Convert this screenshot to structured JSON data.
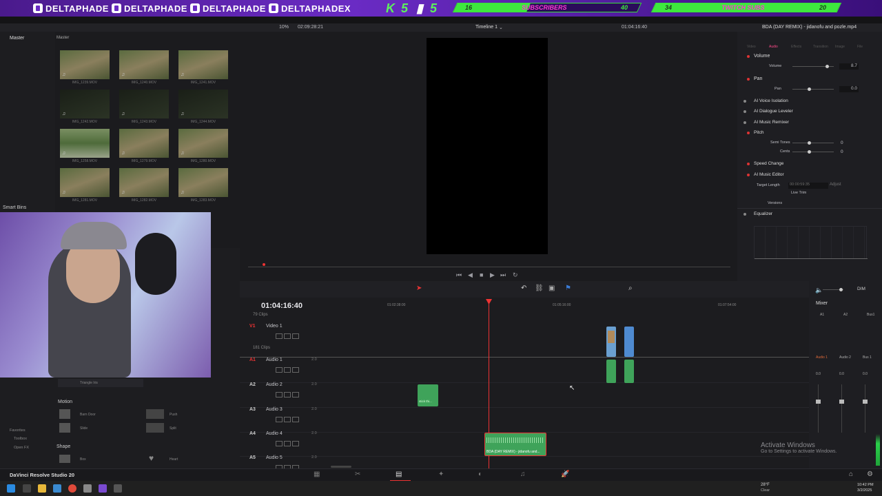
{
  "banner": {
    "handle1": "DELTAPHADE",
    "handle2": "DELTAPHADE",
    "handle3": "DELTAPHADE",
    "handle4": "DELTAPHADEX",
    "counter_a": "5",
    "counter_b": "5",
    "sub_goal": {
      "current": "16",
      "label": "SUBSCRIBERS",
      "target": "40",
      "progress": 0.4
    },
    "twitch_goal": {
      "current": "34",
      "label": "TWITCH SUBS",
      "target": "20",
      "progress": 1.0
    }
  },
  "media_pool": {
    "header": "Master",
    "sidebar_item": "Master",
    "smart_bins": "Smart Bins",
    "clips": [
      {
        "name": "IMG_1239.MOV",
        "style": "dirt"
      },
      {
        "name": "IMG_1240.MOV",
        "style": "dirt"
      },
      {
        "name": "IMG_1241.MOV",
        "style": "dirt"
      },
      {
        "name": "IMG_1242.MOV",
        "style": "dark"
      },
      {
        "name": "IMG_1243.MOV",
        "style": "dark"
      },
      {
        "name": "IMG_1244.MOV",
        "style": "dark"
      },
      {
        "name": "IMG_1258.MOV",
        "style": "grass"
      },
      {
        "name": "IMG_1279.MOV",
        "style": "dirt"
      },
      {
        "name": "IMG_1280.MOV",
        "style": "dirt"
      },
      {
        "name": "IMG_1281.MOV",
        "style": "dirt"
      },
      {
        "name": "IMG_1282.MOV",
        "style": "dirt"
      },
      {
        "name": "IMG_1283.MOV",
        "style": "dirt"
      }
    ]
  },
  "viewer": {
    "zoom": "10%",
    "source_tc": "02:09:28:21",
    "timeline_name": "Timeline 1",
    "record_tc": "01:04:16:40"
  },
  "inspector": {
    "clip_title": "BDA (DAY REMIX) - jidanofu and pozle.mp4",
    "tabs": [
      "Video",
      "Audio",
      "Effects",
      "Transition",
      "Image",
      "File"
    ],
    "active_tab": "Audio",
    "volume_label": "Volume",
    "volume_sub": "Volume",
    "volume_value": "8.7",
    "pan_label": "Pan",
    "pan_sub": "Pan",
    "pan_value": "0.0",
    "voice_iso": "AI Voice Isolation",
    "dialogue": "AI Dialogue Leveler",
    "music_remixer": "AI Music Remixer",
    "pitch": "Pitch",
    "semi_tones": "Semi Tones",
    "semi_value": "0",
    "cents": "Cents",
    "cents_value": "0",
    "speed_change": "Speed Change",
    "music_editor": "AI Music Editor",
    "target_length": "Target Length",
    "target_value": "00:00:59:35",
    "adjust": "Adjust",
    "live_trim": "Live Trim",
    "versions": "Versions",
    "equalizer": "Equalizer"
  },
  "timeline": {
    "timecode": "01:04:16:40",
    "ruler": [
      "01:02:38:00",
      "01:05:16:00",
      "01:07:54:00"
    ],
    "v_clips_top": "79 Clips",
    "tracks": [
      {
        "id": "V1",
        "name": "Video 1",
        "clips": "181 Clips"
      },
      {
        "id": "A1",
        "name": "Audio 1",
        "ch": "2.0"
      },
      {
        "id": "A2",
        "name": "Audio 2",
        "ch": "2.0"
      },
      {
        "id": "A3",
        "name": "Audio 3",
        "ch": "2.0"
      },
      {
        "id": "A4",
        "name": "Audio 4",
        "ch": "2.0"
      },
      {
        "id": "A5",
        "name": "Audio 5",
        "ch": "2.0"
      }
    ],
    "clip_a2_label": "stick thi...",
    "clip_a4_label": "BDA (DAY REMIX) - jidanofu and..."
  },
  "effects": {
    "item_top": "Triangle Iris",
    "section_motion": "Motion",
    "barn_door": "Barn Door",
    "push": "Push",
    "slide": "Slide",
    "split": "Split",
    "section_shape": "Shape",
    "box": "Box",
    "heart": "Heart",
    "favorites": "Favorites",
    "toolbox": "Toolbox",
    "openfx": "Open FX"
  },
  "mixer": {
    "title": "Mixer",
    "cols": [
      "A1",
      "A2",
      "Bus1"
    ],
    "strips": [
      "Audio 1",
      "Audio 2",
      "Bus 1"
    ],
    "dim": "DIM",
    "vals": [
      "0.0",
      "0.0",
      "0.0"
    ]
  },
  "watermark": {
    "line1": "Activate Windows",
    "line2": "Go to Settings to activate Windows."
  },
  "app_name": "DaVinci Resolve Studio 20",
  "taskbar": {
    "weather_temp": "28°F",
    "weather_desc": "Clear",
    "time": "10:42 PM",
    "date": "3/2/2025"
  }
}
